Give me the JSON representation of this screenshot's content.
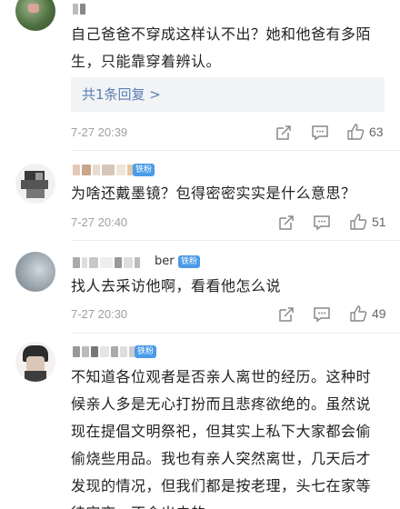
{
  "comments": [
    {
      "username": "",
      "has_badge": false,
      "text": "自己爸爸不穿成这样认不出？她和他爸有多陌生，只能靠穿着辨认。",
      "reply_link": "共1条回复 >",
      "date": "7-27 20:39",
      "likes": "63"
    },
    {
      "username": "",
      "badge": "铁粉",
      "text": "为啥还戴墨镜？包得密密实实是什么意思？",
      "date": "7-27 20:40",
      "likes": "51"
    },
    {
      "username_visible": "ber",
      "badge": "铁粉",
      "text": "找人去采访他啊，看看他怎么说",
      "date": "7-27 20:30",
      "likes": "49"
    },
    {
      "username": "",
      "badge": "铁粉",
      "text": "不知道各位观者是否亲人离世的经历。这种时候亲人多是无心打扮而且悲疼欲绝的。虽然说现在提倡文明祭祀，但其实上私下大家都会偷偷烧些用品。我也有亲人突然离世，几天后才发现的情况，但我们都是按老理，头七在家等待守夜，不会出去的",
      "date": "",
      "likes": ""
    }
  ],
  "icons": [
    "share-icon",
    "comment-icon",
    "like-icon"
  ],
  "colors": {
    "link": "#5a7fb4",
    "badge": "#4a9be8",
    "meta": "#a0a0a0",
    "reply_bg": "#f2f3f5"
  }
}
